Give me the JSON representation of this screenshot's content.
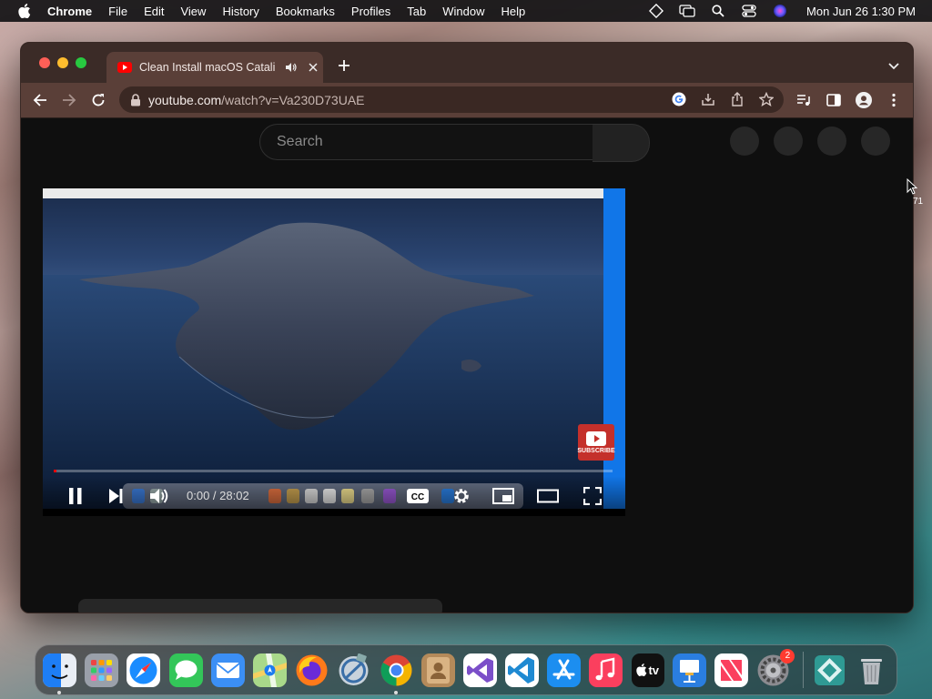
{
  "menubar": {
    "app_name": "Chrome",
    "menus": [
      "File",
      "Edit",
      "View",
      "History",
      "Bookmarks",
      "Profiles",
      "Tab",
      "Window",
      "Help"
    ],
    "clock": "Mon Jun 26  1:30 PM"
  },
  "browser": {
    "tab_title": "Clean Install macOS Catalina",
    "url_domain": "youtube.com",
    "url_path": "/watch?v=Va230D73UAE"
  },
  "youtube": {
    "search_placeholder": "Search",
    "player": {
      "time_current": "0:00",
      "time_separator": " / ",
      "time_total": "28:02",
      "progress_fraction": 0.005,
      "subscribe_label": "SUBSCRIBE",
      "cc_label": "CC"
    }
  },
  "peek_text": "71",
  "dock": {
    "apps": [
      {
        "name": "finder",
        "color": "#1e7ef5",
        "label": ""
      },
      {
        "name": "launchpad",
        "color": "#8a8f99",
        "label": ""
      },
      {
        "name": "safari",
        "color": "#1a8cff",
        "label": ""
      },
      {
        "name": "messages",
        "color": "#33c659",
        "label": ""
      },
      {
        "name": "mail",
        "color": "#3b8ff5",
        "label": ""
      },
      {
        "name": "maps",
        "color": "#4ab866",
        "label": ""
      },
      {
        "name": "firefox",
        "color": "#ff7a1a",
        "label": ""
      },
      {
        "name": "migration",
        "color": "#7d8c99",
        "label": ""
      },
      {
        "name": "chrome",
        "color": "#eeeeee",
        "label": ""
      },
      {
        "name": "contacts",
        "color": "#b48a5a",
        "label": ""
      },
      {
        "name": "visual-studio",
        "color": "#7b4fc9",
        "label": ""
      },
      {
        "name": "vscode",
        "color": "#1f8ad2",
        "label": ""
      },
      {
        "name": "app-store",
        "color": "#1c8ef0",
        "label": ""
      },
      {
        "name": "music",
        "color": "#fb3f5e",
        "label": ""
      },
      {
        "name": "apple-tv",
        "color": "#111111",
        "label": "tv"
      },
      {
        "name": "keynote",
        "color": "#2a7ee0",
        "label": ""
      },
      {
        "name": "news",
        "color": "#f5f5f5",
        "label": ""
      },
      {
        "name": "system-settings",
        "color": "#8b8b90",
        "label": "",
        "badge": "2"
      }
    ],
    "system_settings_badge": "2"
  }
}
